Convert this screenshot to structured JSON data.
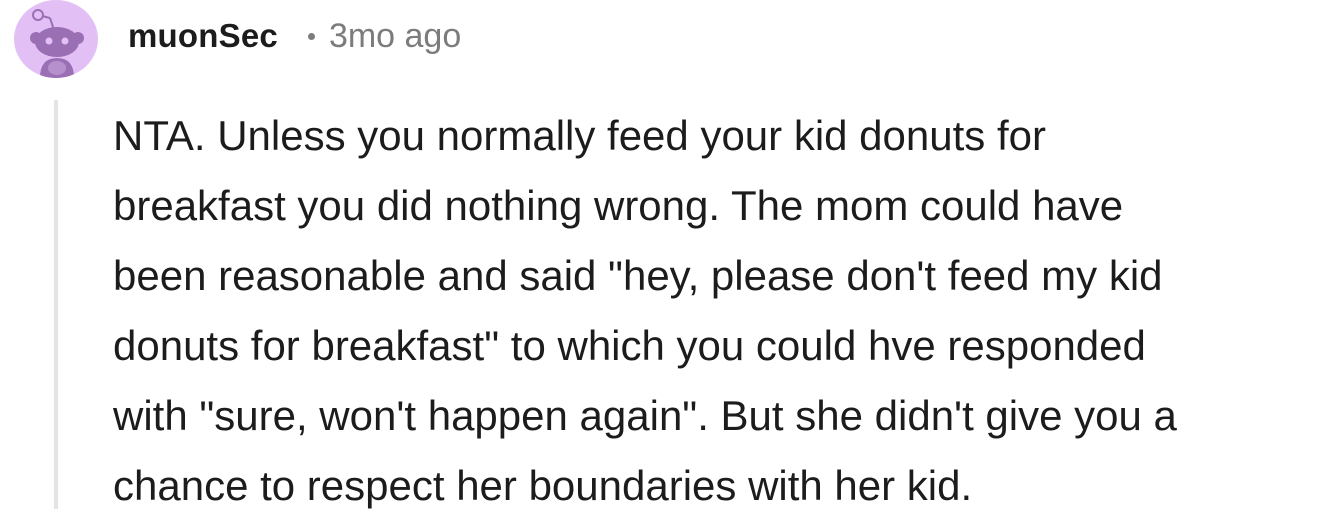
{
  "comment": {
    "author": "muonSec",
    "separator": "•",
    "timestamp": "3mo ago",
    "body": "NTA. Unless you normally feed your kid donuts for\nbreakfast you did nothing wrong. The mom could have\nbeen reasonable and said \"hey, please don't feed my kid\ndonuts for breakfast\" to which you could hve responded\nwith \"sure, won't happen again\". But she didn't give you a\nchance to respect her boundaries with her kid."
  },
  "avatar": {
    "icon": "snoo-avatar-icon",
    "background_color": "#e2c0f5",
    "figure_color": "#9a6fb3"
  },
  "colors": {
    "text": "#1c1c1c",
    "meta": "#7c7c7c",
    "thread_line": "#e4e4e4"
  }
}
